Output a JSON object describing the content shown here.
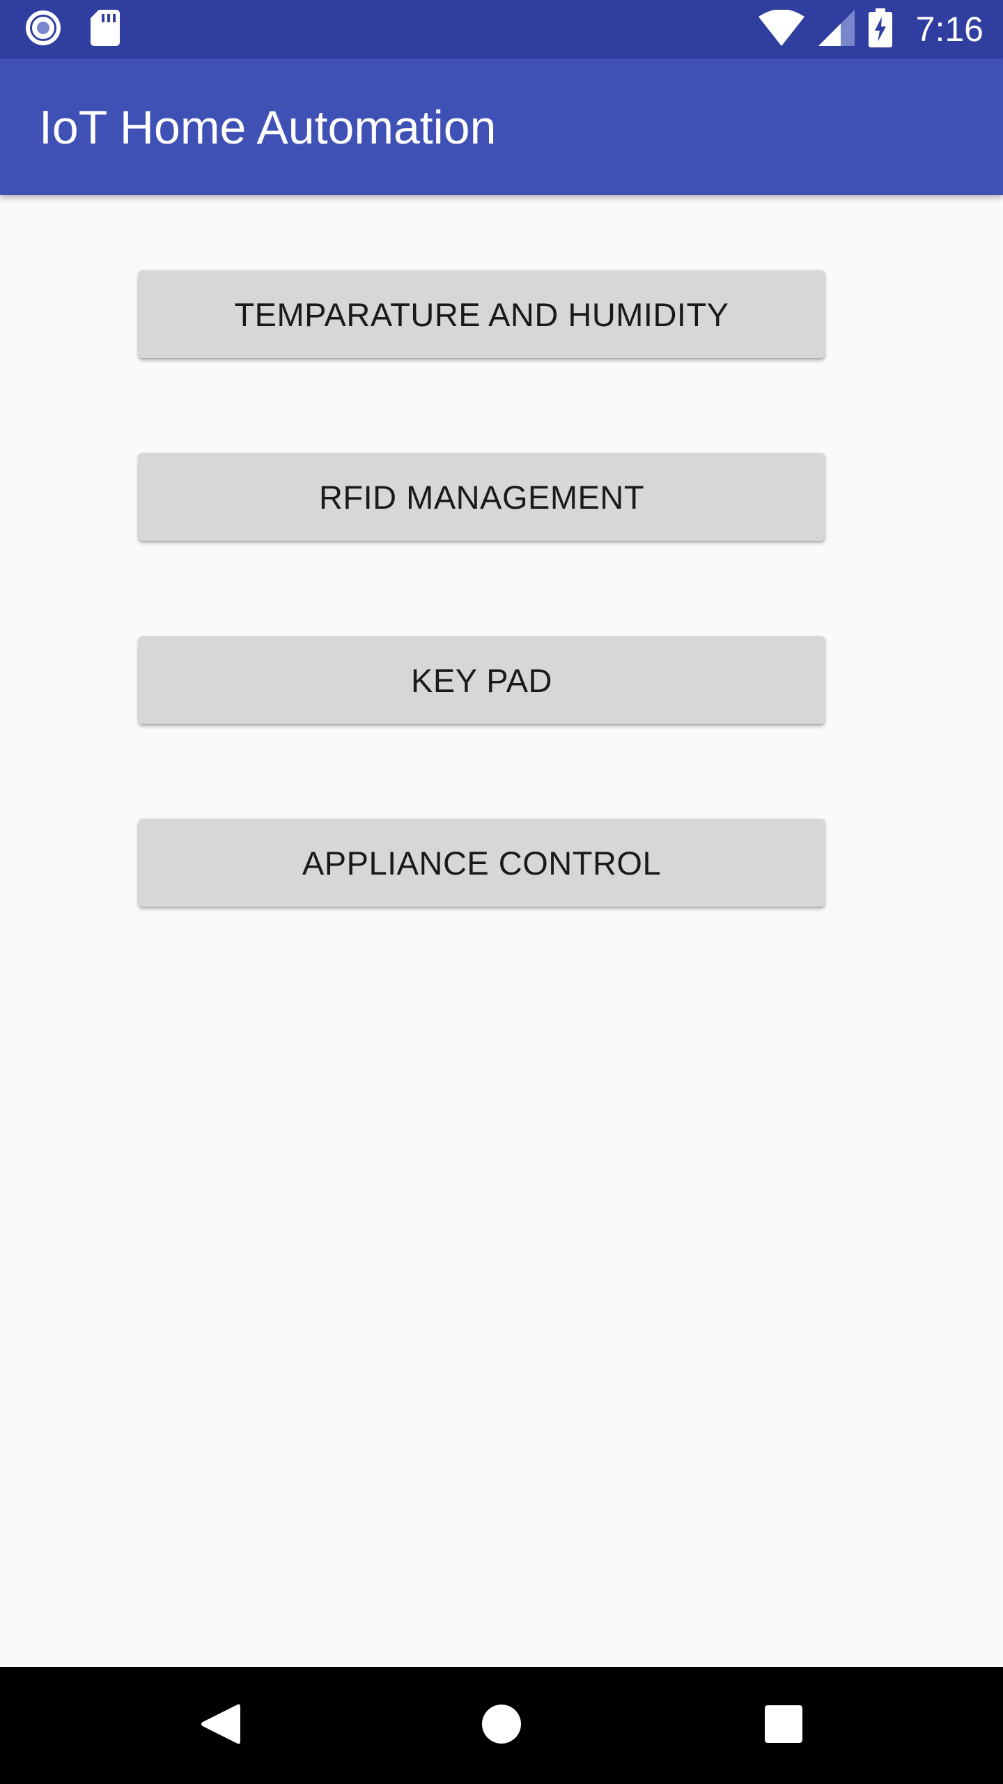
{
  "status_bar": {
    "time": "7:16",
    "icons": [
      "notification-record-icon",
      "sd-card-icon",
      "wifi-icon",
      "cellular-signal-icon",
      "battery-charging-icon"
    ]
  },
  "app_bar": {
    "title": "IoT Home Automation"
  },
  "menu": {
    "buttons": [
      {
        "label": "TEMPARATURE AND HUMIDITY"
      },
      {
        "label": "RFID MANAGEMENT"
      },
      {
        "label": "KEY PAD"
      },
      {
        "label": "APPLIANCE CONTROL"
      }
    ]
  },
  "nav_bar": {
    "icons": [
      "back-icon",
      "home-icon",
      "recents-icon"
    ]
  },
  "colors": {
    "status_bar": "#303f9f",
    "app_bar": "#3f51b5",
    "background": "#fafafa",
    "button": "#d6d7d7",
    "button_text": "#1a1a1a",
    "nav_bar": "#000000"
  }
}
